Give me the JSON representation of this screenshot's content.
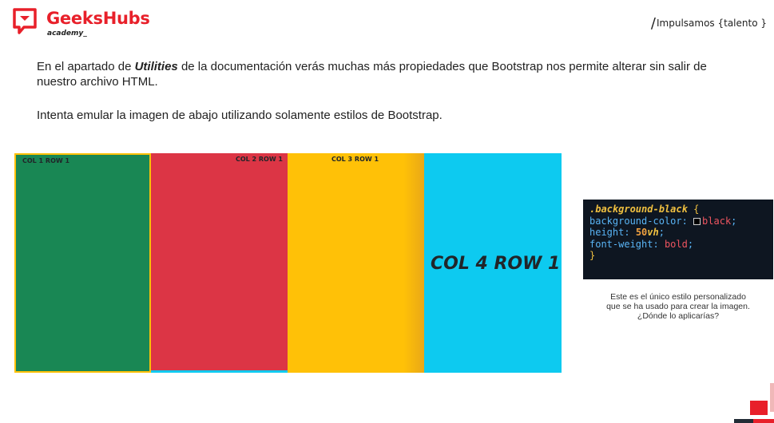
{
  "header": {
    "brand_name": "GeeksHubs",
    "brand_sub": "academy_",
    "slogan": "Impulsamos {talento }",
    "brand_color": "#e8202a"
  },
  "intro": {
    "p1_before": "En el apartado de ",
    "p1_emphasis": "Utilities",
    "p1_after": " de la documentación verás muchas más propiedades que Bootstrap nos permite alterar sin salir de nuestro archivo HTML.",
    "p2": "Intenta emular la imagen de abajo utilizando solamente estilos de Bootstrap."
  },
  "grid": {
    "col1": "COL 1 ROW 1",
    "col2": "COL 2 ROW 1",
    "col3": "COL 3 ROW 1",
    "col4": "COL 4 ROW 1",
    "colors": {
      "col1": "#198754",
      "col2": "#dc3545",
      "col3": "#ffc107",
      "col4": "#0dcaf0"
    }
  },
  "code": {
    "selector": ".background-black",
    "brace_open": "{",
    "brace_close": "}",
    "line1_prop": "background-color",
    "line1_val": "black",
    "line2_prop": "height",
    "line2_num": "50",
    "line2_unit": "vh",
    "line3_prop": "font-weight",
    "line3_val": "bold"
  },
  "caption": {
    "line1": "Este es el único estilo personalizado",
    "line2": "que se ha usado para crear la imagen.",
    "line3": "¿Dónde lo aplicarías?"
  }
}
